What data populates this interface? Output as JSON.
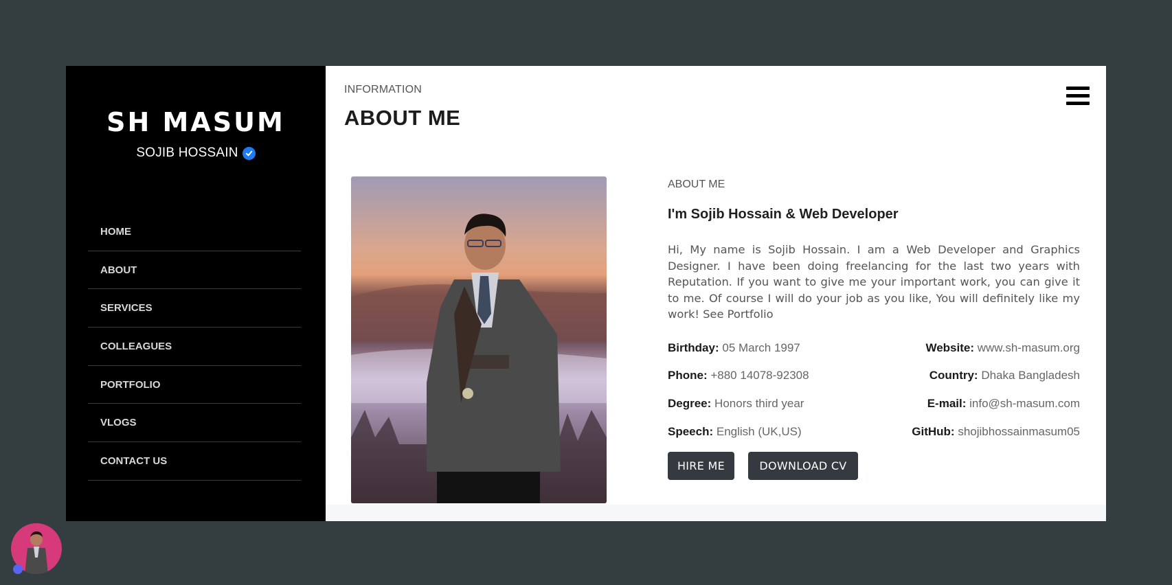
{
  "sidebar": {
    "brand_title": "SH MASUM",
    "brand_subtitle": "SOJIB HOSSAIN",
    "nav": [
      {
        "label": "HOME"
      },
      {
        "label": "ABOUT"
      },
      {
        "label": "SERVICES"
      },
      {
        "label": "COLLEAGUES"
      },
      {
        "label": "PORTFOLIO"
      },
      {
        "label": "VLOGS"
      },
      {
        "label": "CONTACT US"
      }
    ]
  },
  "header": {
    "eyebrow": "INFORMATION",
    "title": "ABOUT ME",
    "menu_icon": "hamburger-icon"
  },
  "about": {
    "eyebrow": "ABOUT ME",
    "heading": "I'm Sojib Hossain & Web Developer",
    "paragraph": "Hi, My name is Sojib Hossain. I am a Web Developer and Graphics Designer. I have been doing freelancing for the last two years with Reputation. If you want to give me your important work, you can give it to me. Of course I will do your job as you like, You will definitely like my work! See Portfolio",
    "info": [
      {
        "left_label": "Birthday:",
        "left_value": "05 March 1997",
        "right_label": "Website:",
        "right_value": "www.sh-masum.org"
      },
      {
        "left_label": "Phone:",
        "left_value": "+880 14078-92308",
        "right_label": "Country:",
        "right_value": "Dhaka Bangladesh"
      },
      {
        "left_label": "Degree:",
        "left_value": "Honors third year",
        "right_label": "E-mail:",
        "right_value": "info@sh-masum.com"
      },
      {
        "left_label": "Speech:",
        "left_value": "English (UK,US)",
        "right_label": "GitHub:",
        "right_value": "shojibhossainmasum05"
      }
    ],
    "hire_label": "HIRE ME",
    "cv_label": "DOWNLOAD CV"
  },
  "colors": {
    "page_bg": "#343d40",
    "sidebar_bg": "#000000",
    "button_bg": "#343a40",
    "verified": "#1d7cf2",
    "avatar_bg": "#d63a7a"
  }
}
